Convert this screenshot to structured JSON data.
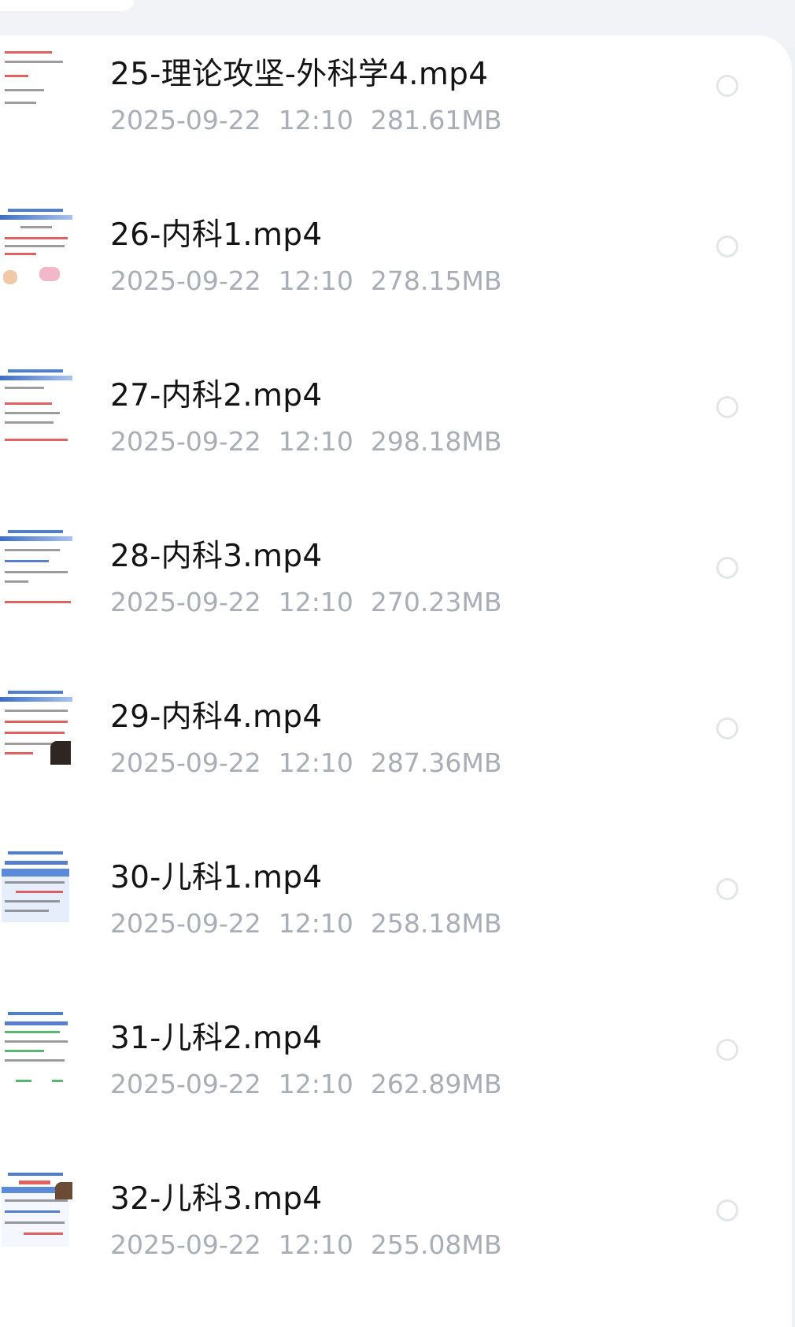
{
  "files": [
    {
      "name": "25-理论攻坚-外科学4.mp4",
      "date": "2025-09-22",
      "time": "12:10",
      "size": "281.61MB"
    },
    {
      "name": "26-内科1.mp4",
      "date": "2025-09-22",
      "time": "12:10",
      "size": "278.15MB"
    },
    {
      "name": "27-内科2.mp4",
      "date": "2025-09-22",
      "time": "12:10",
      "size": "298.18MB"
    },
    {
      "name": "28-内科3.mp4",
      "date": "2025-09-22",
      "time": "12:10",
      "size": "270.23MB"
    },
    {
      "name": "29-内科4.mp4",
      "date": "2025-09-22",
      "time": "12:10",
      "size": "287.36MB"
    },
    {
      "name": "30-儿科1.mp4",
      "date": "2025-09-22",
      "time": "12:10",
      "size": "258.18MB"
    },
    {
      "name": "31-儿科2.mp4",
      "date": "2025-09-22",
      "time": "12:10",
      "size": "262.89MB"
    },
    {
      "name": "32-儿科3.mp4",
      "date": "2025-09-22",
      "time": "12:10",
      "size": "255.08MB"
    }
  ]
}
